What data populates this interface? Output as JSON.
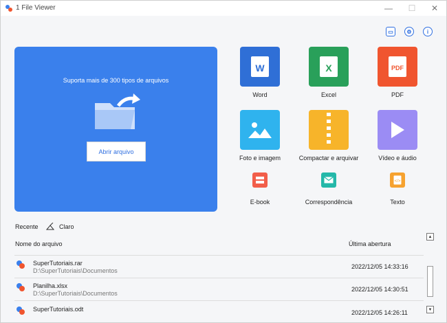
{
  "window": {
    "title": "1 File Viewer"
  },
  "toolbar": {
    "print_icon": "print-icon",
    "settings_icon": "settings-icon",
    "info_icon": "info-icon"
  },
  "hero": {
    "text": "Suporta mais de 300 tipos de arquivos",
    "button": "Abrir arquivo"
  },
  "tiles": [
    {
      "label": "Word",
      "icon": "word-icon",
      "color": "#2f6fd6"
    },
    {
      "label": "Excel",
      "icon": "excel-icon",
      "color": "#29a05a"
    },
    {
      "label": "PDF",
      "icon": "pdf-icon",
      "color": "#f0552f"
    },
    {
      "label": "Foto e imagem",
      "icon": "image-icon",
      "color": "#2fb3ee"
    },
    {
      "label": "Compactar e arquivar",
      "icon": "archive-icon",
      "color": "#f7b42a"
    },
    {
      "label": "Vídeo e áudio",
      "icon": "video-icon",
      "color": "#9b8cf4"
    },
    {
      "label": "E-book",
      "icon": "ebook-icon",
      "color": "#f25e4a"
    },
    {
      "label": "Correspondência",
      "icon": "mail-icon",
      "color": "#24b8a9"
    },
    {
      "label": "Texto",
      "icon": "text-icon",
      "color": "#f6a22f"
    }
  ],
  "recent": {
    "label": "Recente",
    "theme_label": "Claro",
    "col_name": "Nome do arquivo",
    "col_date": "Última abertura",
    "files": [
      {
        "name": "SuperTutoriais.rar",
        "path": "D:\\SuperTutoriais\\Documentos",
        "date": "2022/12/05 14:33:16"
      },
      {
        "name": "Planilha.xlsx",
        "path": "D:\\SuperTutoriais\\Documentos",
        "date": "2022/12/05 14:30:51"
      },
      {
        "name": "SuperTutoriais.odt",
        "path": "",
        "date": "2022/12/05 14:26:11"
      }
    ]
  }
}
